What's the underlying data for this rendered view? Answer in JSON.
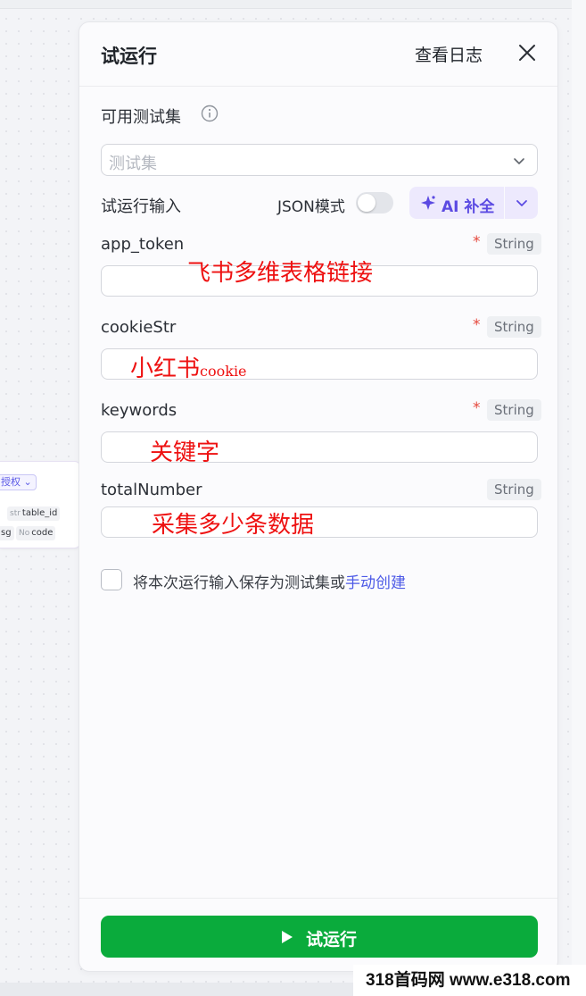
{
  "background_node": {
    "auth_label": "授权",
    "fields": [
      {
        "type": "str",
        "name": "table_id"
      },
      {
        "type": "",
        "name": "sg"
      },
      {
        "type": "No",
        "name": "code"
      }
    ]
  },
  "panel": {
    "title": "试运行",
    "log_button": "查看日志",
    "test_set": {
      "label": "可用测试集",
      "placeholder": "测试集"
    },
    "run_input": {
      "label": "试运行输入",
      "json_mode_label": "JSON模式",
      "json_mode_on": false,
      "ai_fill_label": "AI 补全"
    },
    "fields": [
      {
        "name": "app_token",
        "required": true,
        "type": "String",
        "value": ""
      },
      {
        "name": "cookieStr",
        "required": true,
        "type": "String",
        "value": ""
      },
      {
        "name": "keywords",
        "required": true,
        "type": "String",
        "value": ""
      },
      {
        "name": "totalNumber",
        "required": false,
        "type": "String",
        "value": ""
      }
    ],
    "required_mark": "*",
    "save_option": {
      "text": "将本次运行输入保存为测试集或",
      "link": "手动创建",
      "checked": false
    },
    "run_button": "试运行"
  },
  "annotations": {
    "app_token": "飞书多维表格链接",
    "cookie_main": "小红书",
    "cookie_suffix": "cookie",
    "keywords": "关键字",
    "total": "采集多少条数据"
  },
  "watermark": "318首码网 www.e318.com",
  "colors": {
    "accent_purple": "#5b4ae2",
    "run_green": "#0aab3c",
    "required_red": "#e5483d",
    "link_blue": "#4c59e6",
    "annotation_red": "#ee1111"
  }
}
